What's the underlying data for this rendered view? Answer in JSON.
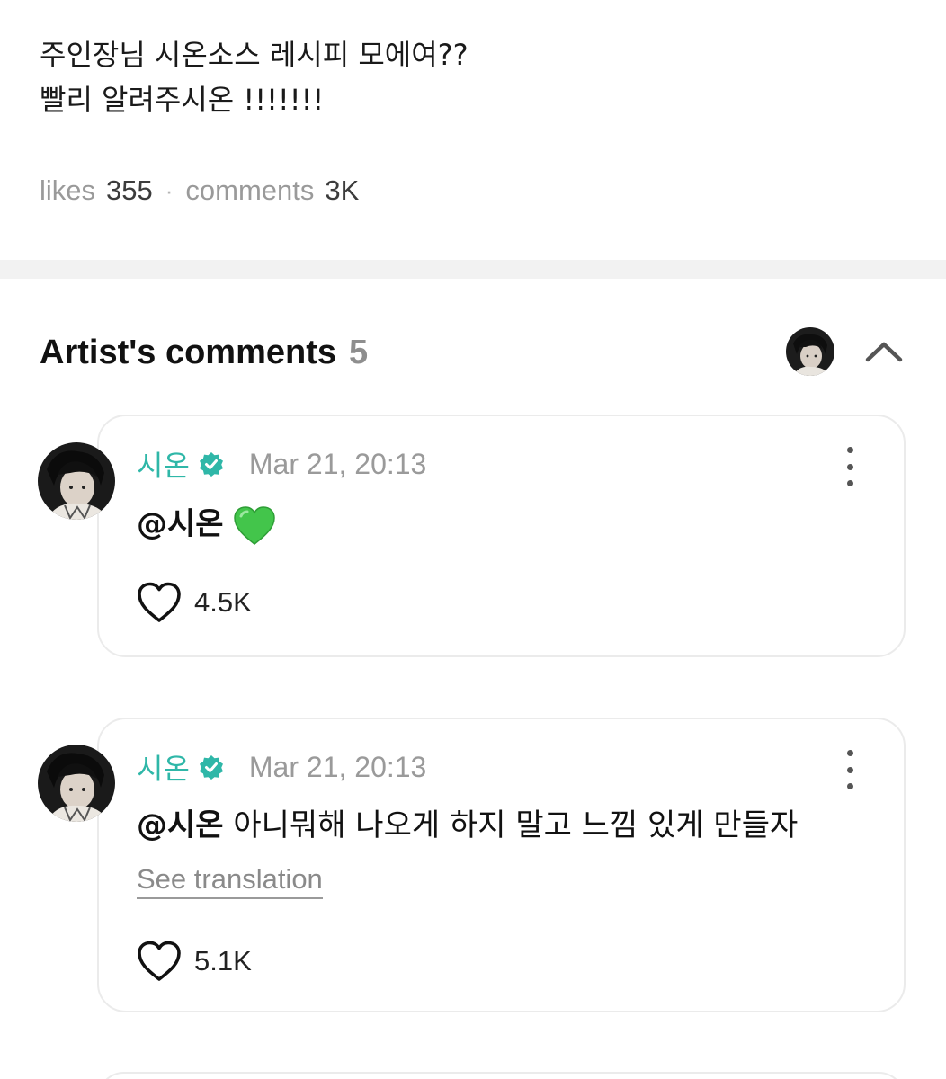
{
  "post": {
    "line1": "주인장님 시온소스 레시피 모에여??",
    "line2": "빨리 알려주시온 !!!!!!!"
  },
  "stats": {
    "likes_label": "likes",
    "likes_count": "355",
    "separator": "·",
    "comments_label": "comments",
    "comments_count": "3K"
  },
  "artist_comments": {
    "title": "Artist's comments",
    "count": "5",
    "comments": [
      {
        "author": "시온",
        "time": "Mar 21, 20:13",
        "mention": "@시온",
        "text": "",
        "emoji": "green-heart",
        "likes": "4.5K"
      },
      {
        "author": "시온",
        "time": "Mar 21, 20:13",
        "mention": "@시온",
        "text": "아니뭐해 나오게 하지 말고 느낌 있게 만들자",
        "translate_label": "See translation",
        "likes": "5.1K"
      }
    ]
  },
  "colors": {
    "author": "#2fb7a8",
    "verified": "#2fb7a8",
    "muted": "#9a9a9a",
    "divider": "#f2f2f2",
    "card_border": "#ebebeb",
    "emoji_heart": "#43c54b"
  }
}
